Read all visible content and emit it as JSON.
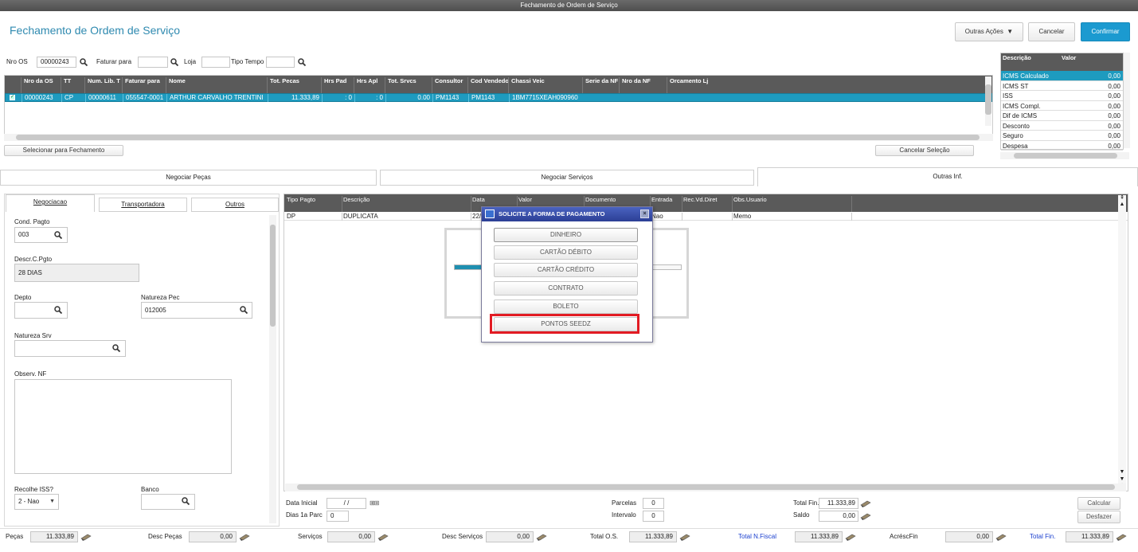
{
  "window": {
    "title": "Fechamento de Ordem de Serviço"
  },
  "header": {
    "title": "Fechamento de Ordem de Serviço",
    "other_actions": "Outras Ações",
    "cancel": "Cancelar",
    "confirm": "Confirmar"
  },
  "filters": {
    "nro_os_label": "Nro OS",
    "nro_os_value": "00000243",
    "faturar_label": "Faturar para",
    "loja_label": "Loja",
    "tipo_tempo_label": "Tipo Tempo"
  },
  "os_grid": {
    "columns": [
      "Nro da OS",
      "TT",
      "Num. Lib. T",
      "Faturar para",
      "Nome",
      "Tot. Pecas",
      "Hrs Pad",
      "Hrs Apl",
      "Tot. Srvcs",
      "Consultor",
      "Cod Vendedo",
      "Chassi Veic",
      "Serie da NF",
      "Nro da NF",
      "Orcamento Lj"
    ],
    "row": [
      "00000243",
      "CP",
      "00000611",
      "055547-0001",
      "ARTHUR CARVALHO TRENTINI",
      "11.333,89",
      ": 0",
      ": 0",
      "0.00",
      "PM1143",
      "PM1143",
      "1BM7715XEAH090960",
      "",
      "",
      ""
    ]
  },
  "select_close": "Selecionar para Fechamento",
  "cancel_selection": "Cancelar Seleção",
  "tax_grid": {
    "col_desc": "Descrição",
    "col_val": "Valor",
    "rows": [
      [
        "ICMS Calculado",
        "0,00"
      ],
      [
        "ICMS ST",
        "0,00"
      ],
      [
        "ISS",
        "0,00"
      ],
      [
        "ICMS Compl.",
        "0,00"
      ],
      [
        "Dif de ICMS",
        "0,00"
      ],
      [
        "Desconto",
        "0,00"
      ],
      [
        "Seguro",
        "0,00"
      ],
      [
        "Despesa",
        "0,00"
      ]
    ]
  },
  "main_tabs": [
    "Negociar Peças",
    "Negociar Serviços",
    "Outras Inf."
  ],
  "sub_tabs": [
    "Negociacao",
    "Transportadora",
    "Outros"
  ],
  "form": {
    "cond_pagto_label": "Cond. Pagto",
    "cond_pagto": "003",
    "descr_label": "Descr.C.Pgto",
    "descr": "28 DIAS",
    "depto_label": "Depto",
    "natureza_pec_label": "Natureza Pec",
    "natureza_pec": "012005",
    "natureza_srv_label": "Natureza Srv",
    "observ_label": "Observ. NF",
    "recolhe_label": "Recolhe ISS?",
    "recolhe": "2 - Nao",
    "banco_label": "Banco"
  },
  "pay_grid": {
    "columns": [
      "Tipo Pagto",
      "Descrição",
      "Data",
      "Valor",
      "Documento",
      "Entrada",
      "Rec.Vd.Diret",
      "Obs.Usuario"
    ],
    "row": [
      "DP",
      "DUPLICATA",
      "22/",
      "",
      "",
      "Nao",
      "",
      "Memo"
    ]
  },
  "pay_footer": {
    "data_inicial_label": "Data Inicial",
    "data_inicial": "/ /",
    "dias_label": "Dias 1a Parc",
    "dias": "0",
    "parcelas_label": "Parcelas",
    "parcelas": "0",
    "intervalo_label": "Intervalo",
    "intervalo": "0",
    "total_fin_label": "Total Fin.",
    "total_fin": "11.333,89",
    "saldo_label": "Saldo",
    "saldo": "0,00",
    "calcular": "Calcular",
    "desfazer": "Desfazer"
  },
  "modal": {
    "title": "SOLICITE A FORMA DE PAGAMENTO",
    "options": [
      "DINHEIRO",
      "CARTÃO DÉBITO",
      "CARTÃO CRÉDITO",
      "CONTRATO",
      "BOLETO",
      "PONTOS SEEDZ"
    ]
  },
  "totals": [
    {
      "label": "Peças",
      "value": "11.333,89",
      "blue": false
    },
    {
      "label": "Desc Peças",
      "value": "0,00",
      "blue": false
    },
    {
      "label": "Serviços",
      "value": "0,00",
      "blue": false
    },
    {
      "label": "Desc Serviços",
      "value": "0,00",
      "blue": false
    },
    {
      "label": "Total O.S.",
      "value": "11.333,89",
      "blue": false
    },
    {
      "label": "Total N.Fiscal",
      "value": "11.333,89",
      "blue": true
    },
    {
      "label": "AcréscFin",
      "value": "0,00",
      "blue": false
    },
    {
      "label": "Total Fin.",
      "value": "11.333,89",
      "blue": true
    }
  ],
  "colors": {
    "accent": "#1b9ad0",
    "highlight": "#e21b23"
  }
}
